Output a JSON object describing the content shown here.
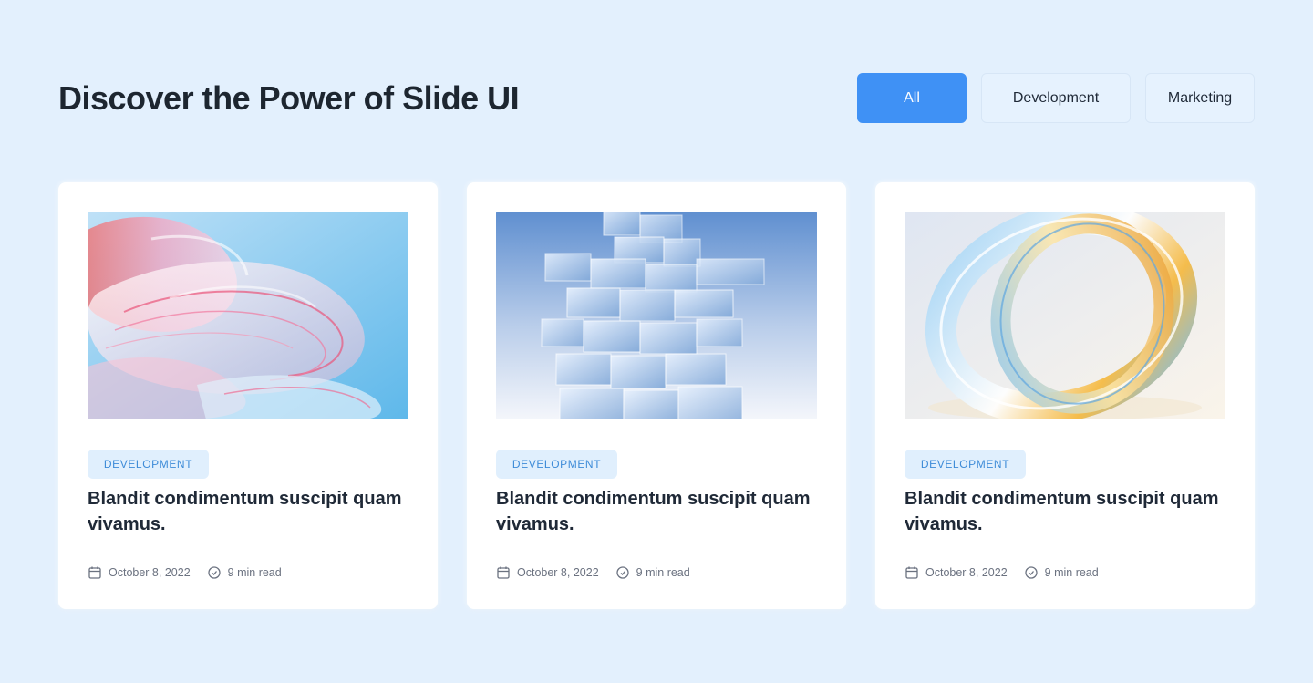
{
  "header": {
    "title": "Discover the Power of Slide UI"
  },
  "filters": [
    {
      "label": "All",
      "active": true
    },
    {
      "label": "Development",
      "active": false
    },
    {
      "label": "Marketing",
      "active": false
    }
  ],
  "cards": [
    {
      "image": "abstract-pink-glass-waves",
      "tag": "DEVELOPMENT",
      "title": "Blandit condimentum suscipit quam vivamus.",
      "date": "October 8, 2022",
      "read_time": "9 min read"
    },
    {
      "image": "glass-cube-tower",
      "tag": "DEVELOPMENT",
      "title": "Blandit condimentum suscipit quam vivamus.",
      "date": "October 8, 2022",
      "read_time": "9 min read"
    },
    {
      "image": "glass-ring-rainbow",
      "tag": "DEVELOPMENT",
      "title": "Blandit condimentum suscipit quam vivamus.",
      "date": "October 8, 2022",
      "read_time": "9 min read"
    }
  ],
  "icons": {
    "date": "calendar-icon",
    "read_time": "clock-icon"
  },
  "colors": {
    "background": "#e3f0fd",
    "accent": "#3f91f5",
    "tag_bg": "#e0effd",
    "tag_text": "#3d8bd8",
    "heading": "#1d2630"
  }
}
